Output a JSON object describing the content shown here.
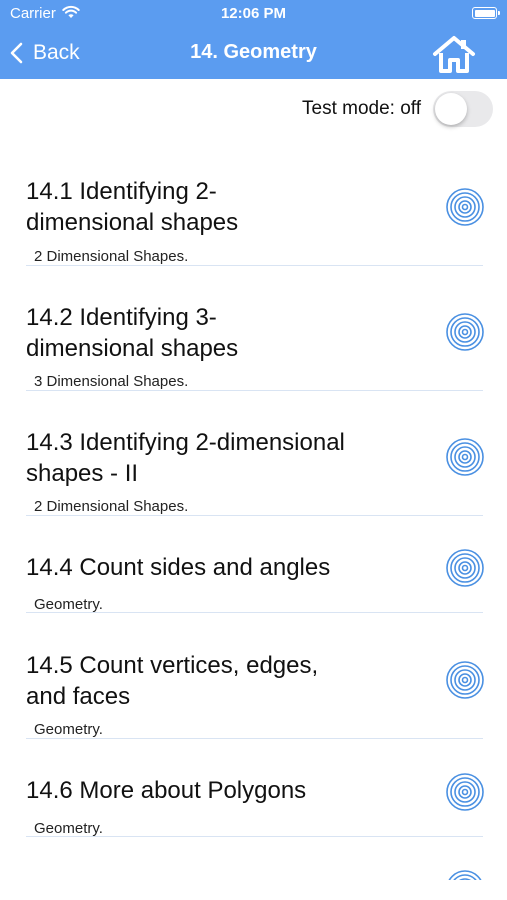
{
  "status_bar": {
    "carrier": "Carrier",
    "time": "12:06 PM",
    "wifi_icon": "wifi-icon",
    "battery_icon": "battery-icon"
  },
  "nav": {
    "back_label": "Back",
    "title": "14. Geometry",
    "home_icon": "home-icon",
    "background_color": "#5b9cf0"
  },
  "test_mode": {
    "label": "Test mode: off",
    "enabled": false
  },
  "lessons": [
    {
      "title": "14.1 Identifying 2-dimensional shapes",
      "title_lines": [
        "14.1 Identifying 2-",
        "dimensional shapes"
      ],
      "subtitle": "2 Dimensional Shapes.",
      "icon": "target-icon"
    },
    {
      "title": "14.2 Identifying 3-dimensional shapes",
      "title_lines": [
        "14.2 Identifying 3-",
        "dimensional shapes"
      ],
      "subtitle": "3 Dimensional Shapes.",
      "icon": "target-icon"
    },
    {
      "title": "14.3 Identifying 2-dimensional shapes - II",
      "title_lines": [
        "14.3 Identifying 2-dimensional",
        "shapes - II"
      ],
      "subtitle": "2 Dimensional Shapes.",
      "icon": "target-icon"
    },
    {
      "title": "14.4 Count sides and angles",
      "title_lines": [
        "14.4 Count sides and angles"
      ],
      "subtitle": "Geometry.",
      "icon": "target-icon"
    },
    {
      "title": "14.5 Count vertices, edges, and faces",
      "title_lines": [
        "14.5 Count vertices, edges,",
        "and faces"
      ],
      "subtitle": "Geometry.",
      "icon": "target-icon"
    },
    {
      "title": "14.6 More about Polygons",
      "title_lines": [
        "14.6 More about Polygons"
      ],
      "subtitle": "Geometry.",
      "icon": "target-icon"
    }
  ],
  "accent_color": "#4a90e2"
}
